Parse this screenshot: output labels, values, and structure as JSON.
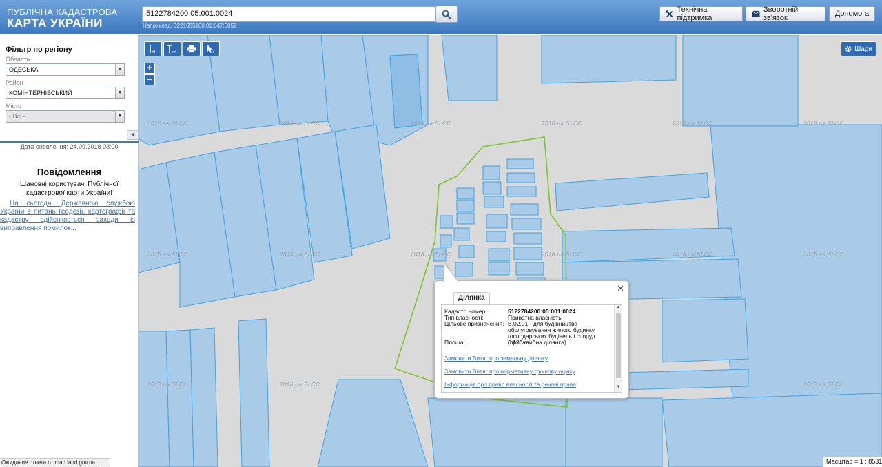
{
  "header": {
    "logo_line1": "ПУБЛІЧНА КАДАСТРОВА",
    "logo_line2": "КАРТА УКРАЇНИ",
    "search_value": "5122784200:05:001:0024",
    "search_hint": "Наприклад, 3221655100:01:047:0052",
    "btn_support": "Технічна підтримка",
    "btn_feedback": "Зворотній зв'язок",
    "btn_help": "Допомога"
  },
  "sidebar": {
    "filter_title": "Фільтр по регіону",
    "oblast_label": "Область",
    "oblast_value": "ОДЕСЬКА",
    "rayon_label": "Район",
    "rayon_value": "КОМІНТЕРНІВСЬКИЙ",
    "misto_label": "Місто",
    "misto_value": "- Всі -",
    "update_date": "Дата оновлення: 24.09.2018 03:00",
    "notice_title": "Повідомлення",
    "notice_text": "Шановні користувачі Публічної кадастрової карти України!",
    "notice_link": "На сьогодні Державною службою України з питань геодезії, картографії та кадастру здійснюються заходи із виправлення помилок..."
  },
  "status_text": "Ожидание ответа от map.land.gov.ua...",
  "map": {
    "layers_label": "Шари",
    "scale_text": "Масштаб = 1 : 8531",
    "watermark": "2018.ua.SLCC"
  },
  "popup": {
    "tab_label": "Ділянка",
    "rows": [
      {
        "key": "Кадастр.номер:",
        "value": "5122784200:05:001:0024"
      },
      {
        "key": "Тип власності:",
        "value": "Приватна власність"
      },
      {
        "key": "Цільове призначення:",
        "value": "В.02.01 - для будівництва і обслуговування жилого будинку, господарських будівель і споруд (присадибна ділянка)"
      },
      {
        "key": "Площа:",
        "value": "0.126 га"
      }
    ],
    "link1": "Замовити Витяг про земельну ділянку",
    "link2": "Замовити Витяг про нормативну грошову оцінку",
    "link3": "Інформація про право власності та речові права"
  },
  "colors": {
    "header_blue": "#3d78c0",
    "parcel_fill": "#a9cbe8",
    "parcel_stroke": "#3ba3e6",
    "selection": "#7dc42b"
  }
}
